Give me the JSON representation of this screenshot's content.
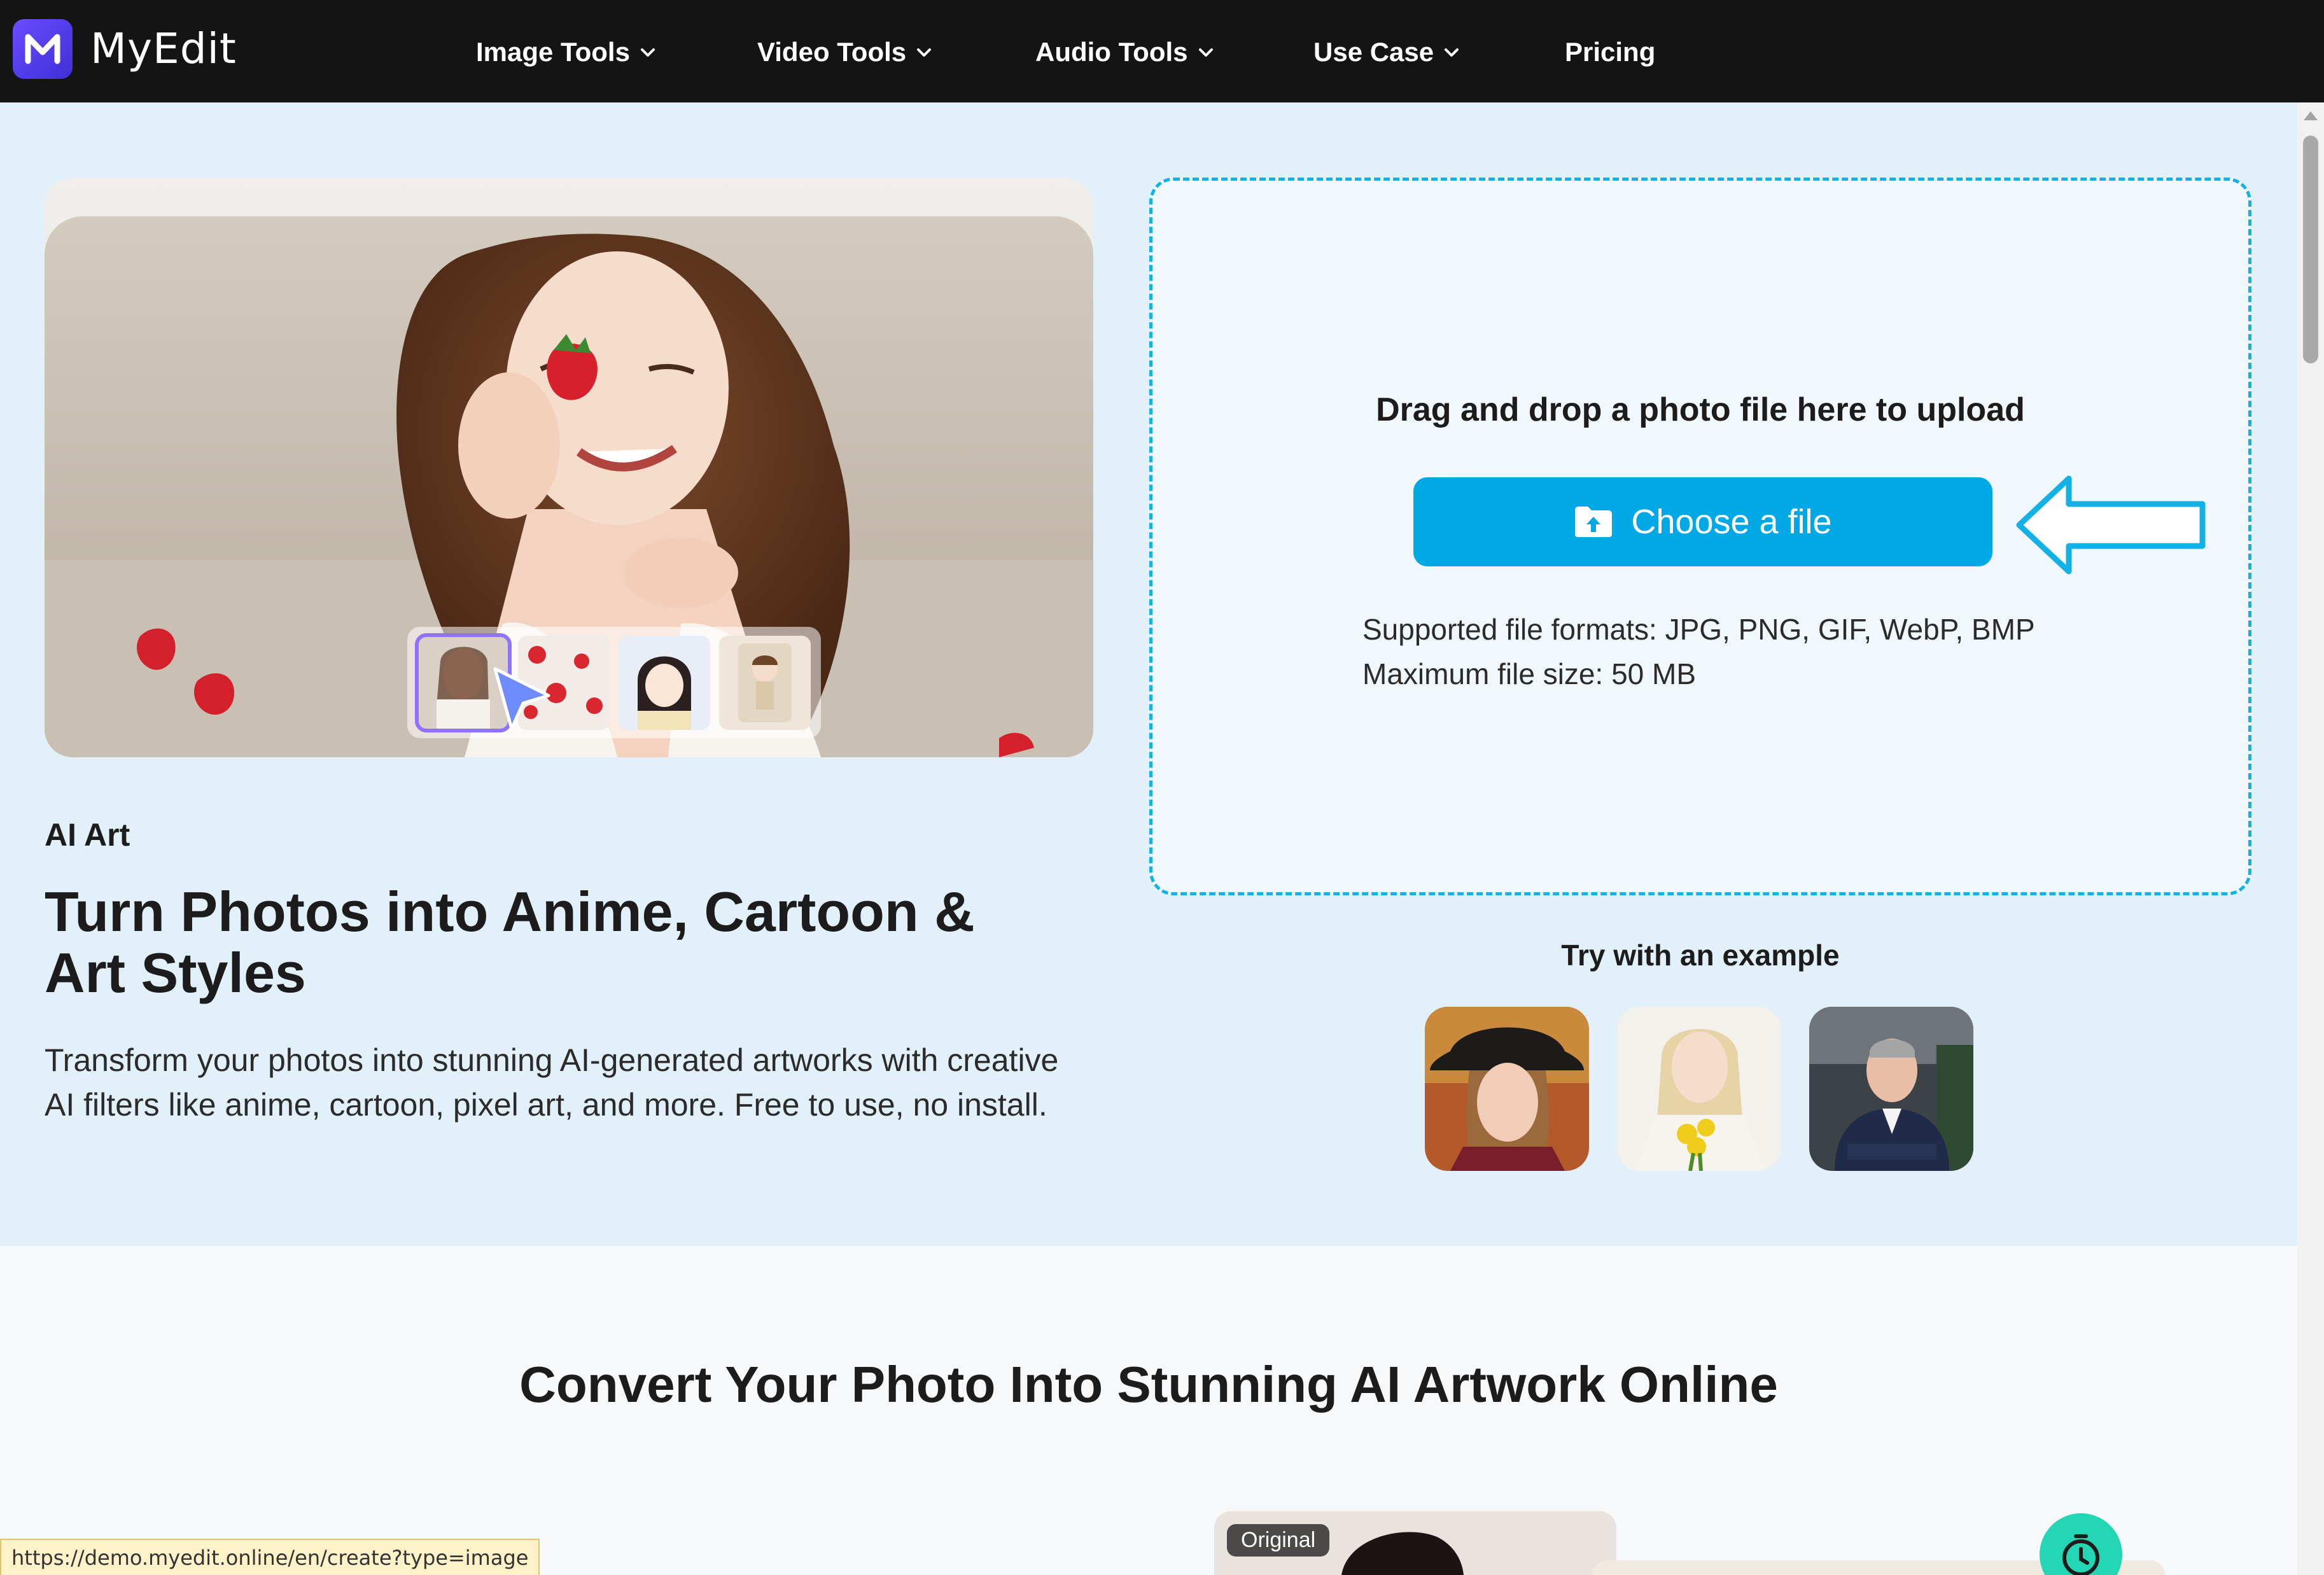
{
  "brand": {
    "name": "MyEdit",
    "logo_letter": "M"
  },
  "nav": {
    "items": [
      {
        "label": "Image Tools",
        "has_dropdown": true
      },
      {
        "label": "Video Tools",
        "has_dropdown": true
      },
      {
        "label": "Audio Tools",
        "has_dropdown": true
      },
      {
        "label": "Use Case",
        "has_dropdown": true
      },
      {
        "label": "Pricing",
        "has_dropdown": false
      }
    ]
  },
  "hero": {
    "eyebrow": "AI Art",
    "headline_line1": "Turn Photos into Anime, Cartoon &",
    "headline_line2": "Art Styles",
    "description": "Transform your photos into stunning AI-generated artworks with creative AI filters like anime, cartoon, pixel art, and more. Free to use, no install."
  },
  "upload": {
    "title": "Drag and drop a photo file here to upload",
    "button_label": "Choose a file",
    "formats_line": "Supported file formats: JPG, PNG, GIF, WebP, BMP",
    "size_line": "Maximum file size: 50 MB"
  },
  "examples": {
    "label": "Try with an example",
    "items": [
      "woman-with-hat-example",
      "woman-with-flowers-example",
      "man-in-suit-example"
    ]
  },
  "section": {
    "title": "Convert Your Photo Into Stunning AI Artwork Online",
    "preview_badge": "Original"
  },
  "status_bar": {
    "url": "https://demo.myedit.online/en/create?type=image"
  },
  "colors": {
    "nav_bg": "#141414",
    "hero_bg": "#e2f0f9",
    "accent": "#00a9e6",
    "dropzone_border": "#12b1e6",
    "logo": "#5a3ff0",
    "fab": "#23d6b4"
  }
}
